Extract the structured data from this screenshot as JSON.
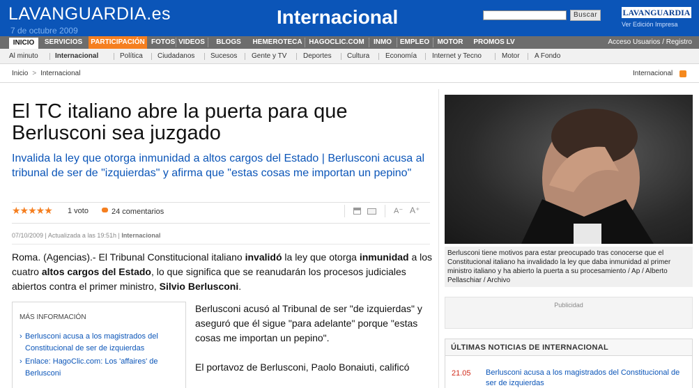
{
  "header": {
    "logo_main": "LAVANGUARDIA",
    "logo_domain": ".es",
    "date": "7 de octubre 2009",
    "section_title": "Internacional",
    "search_button": "Buscar",
    "brand": "LAVANGUARDIA",
    "edicion": "Ver Edición Impresa"
  },
  "nav": {
    "items": [
      "INICIO",
      "SERVICIOS",
      "PARTICIPACIÓN",
      "FOTOS",
      "VIDEOS",
      "BLOGS",
      "HEMEROTECA",
      "HAGOCLIC.COM",
      "INMO",
      "EMPLEO",
      "MOTOR",
      "PROMOS LV"
    ],
    "access": "Acceso Usuarios / Registro"
  },
  "subnav": {
    "items": [
      "Al minuto",
      "Internacional",
      "Política",
      "Ciudadanos",
      "Sucesos",
      "Gente y TV",
      "Deportes",
      "Cultura",
      "Economía",
      "Internet y Tecno",
      "Motor",
      "A Fondo"
    ]
  },
  "breadcrumb": {
    "home": "Inicio",
    "arrow": ">",
    "current": "Internacional",
    "rss": "Internacional"
  },
  "article": {
    "headline": "El TC italiano abre la puerta para que Berlusconi sea juzgado",
    "subhead": "Invalida la ley que otorga inmunidad a altos cargos del Estado  |  Berlusconi acusa al tribunal de ser de \"izquierdas\" y afirma que \"estas cosas me importan un pepino\"",
    "stars": "★★★★★",
    "votes": "1 voto",
    "comments": "24 comentarios",
    "font_dec": "A⁻",
    "font_inc": "A⁺",
    "meta_date": "07/10/2009",
    "meta_updated": "Actualizada a las 19:51h",
    "meta_section": "Internacional",
    "lead_1": "Roma. (Agencias).- El Tribunal Constitucional italiano ",
    "lead_b1": "invalidó",
    "lead_2": " la ley que otorga ",
    "lead_b2": "inmunidad",
    "lead_3": " a los cuatro ",
    "lead_b3": "altos cargos del Estado",
    "lead_4": ", lo que significa que se reanudarán los procesos judiciales abiertos contra el primer ministro, ",
    "lead_b4": "Silvio Berlusconi",
    "lead_5": ".",
    "body_p1": "Berlusconi acusó al Tribunal de ser \"de izquierdas\" y aseguró que él sigue \"para adelante\" porque \"estas cosas me importan un pepino\".",
    "body_p2": "El portavoz de Berlusconi, Paolo Bonaiuti, calificó"
  },
  "more_info": {
    "title": "MÁS INFORMACIÓN",
    "links": [
      "Berlusconi acusa a los magistrados del Constitucional de ser de izquierdas",
      "Enlace: HagoClic.com: Los 'affaires' de Berlusconi"
    ]
  },
  "photo": {
    "caption": "Berlusconi tiene motivos para estar preocupado tras conocerse que el Constitucional italiano ha invalidado la ley que daba inmunidad al primer ministro italiano y ha abierto la puerta a su procesamiento / Ap / Alberto Pellaschiar / Archivo"
  },
  "ad": {
    "label": "Publicidad"
  },
  "latest": {
    "title": "ÚLTIMAS NOTICIAS DE INTERNACIONAL",
    "items": [
      {
        "time": "21.05",
        "text": "Berlusconi acusa a los magistrados del Constitucional de ser de izquierdas"
      }
    ]
  },
  "colors": {
    "brand_blue": "#0b55b8",
    "nav_gray": "#6d6d6d",
    "accent_orange": "#f57f20"
  }
}
